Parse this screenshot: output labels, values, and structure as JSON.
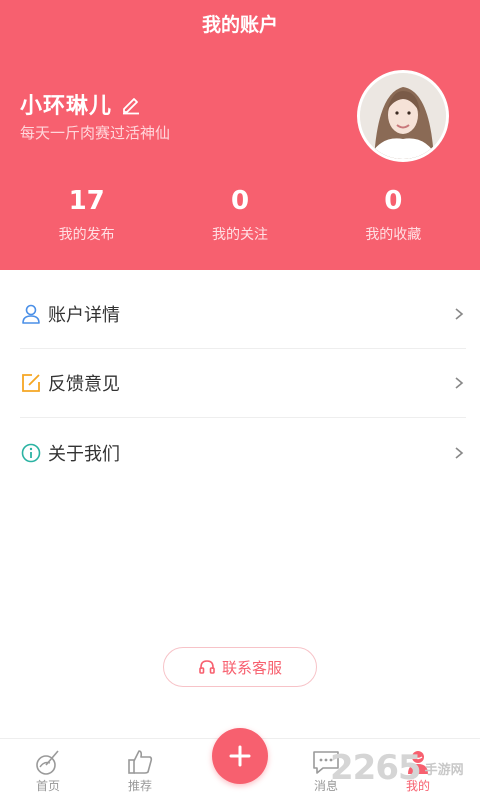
{
  "header": {
    "title": "我的账户",
    "username": "小环琳儿",
    "bio": "每天一斤肉赛过活神仙",
    "background_color": "#f7606f"
  },
  "stats": [
    {
      "value": "17",
      "label": "我的发布"
    },
    {
      "value": "0",
      "label": "我的关注"
    },
    {
      "value": "0",
      "label": "我的收藏"
    }
  ],
  "menu": [
    {
      "label": "账户详情",
      "icon": "user-icon",
      "icon_color": "#4a8fe7"
    },
    {
      "label": "反馈意见",
      "icon": "edit-square-icon",
      "icon_color": "#f5a623"
    },
    {
      "label": "关于我们",
      "icon": "info-icon",
      "icon_color": "#2bb3a3"
    }
  ],
  "service_button": {
    "label": "联系客服",
    "icon": "headset-icon"
  },
  "tabbar": {
    "tabs": [
      {
        "label": "首页",
        "icon": "home-guitar-icon"
      },
      {
        "label": "推荐",
        "icon": "thumbs-up-icon"
      },
      {
        "label": "消息",
        "icon": "message-icon"
      },
      {
        "label": "我的",
        "icon": "profile-icon",
        "active": true
      }
    ],
    "plus_icon": "plus-icon"
  },
  "watermark": {
    "number": "2265",
    "text": "手游网"
  }
}
